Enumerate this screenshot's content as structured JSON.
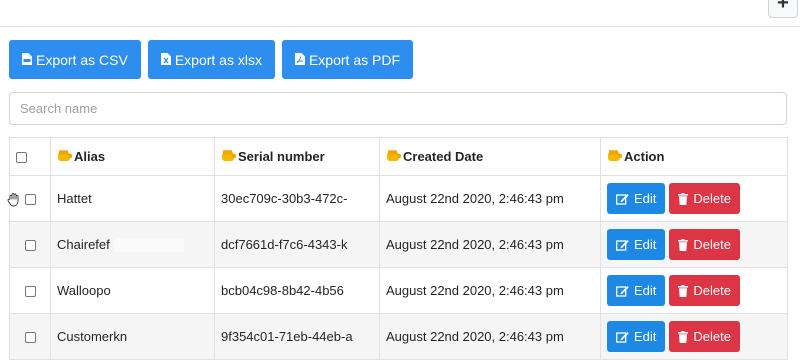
{
  "toolbar": {
    "add_label": "+"
  },
  "exports": [
    {
      "label": "Export as CSV",
      "icon": "file-csv-icon"
    },
    {
      "label": "Export as xlsx",
      "icon": "file-excel-icon"
    },
    {
      "label": "Export as PDF",
      "icon": "file-pdf-icon"
    }
  ],
  "search": {
    "placeholder": "Search name",
    "value": ""
  },
  "table": {
    "headers": {
      "alias": "Alias",
      "serial": "Serial number",
      "created": "Created Date",
      "action": "Action"
    },
    "header_icon": "fist-icon",
    "rows": [
      {
        "alias": "Hattet",
        "serial": "30ec709c-30b3-472c-",
        "created": "August 22nd 2020, 2:46:43 pm"
      },
      {
        "alias": "Chairefef",
        "serial": "dcf7661d-f7c6-4343-k",
        "created": "August 22nd 2020, 2:46:43 pm"
      },
      {
        "alias": "Walloopo",
        "serial": "bcb04c98-8b42-4b56",
        "created": "August 22nd 2020, 2:46:43 pm"
      },
      {
        "alias": "Customerkn",
        "serial": "9f354c01-71eb-44eb-a",
        "created": "August 22nd 2020, 2:46:43 pm"
      }
    ],
    "edit_label": "Edit",
    "delete_label": "Delete"
  },
  "colors": {
    "primary": "#2e8ef0",
    "edit": "#1e88e5",
    "danger": "#dc3545",
    "header_icon": "#f5b800"
  }
}
